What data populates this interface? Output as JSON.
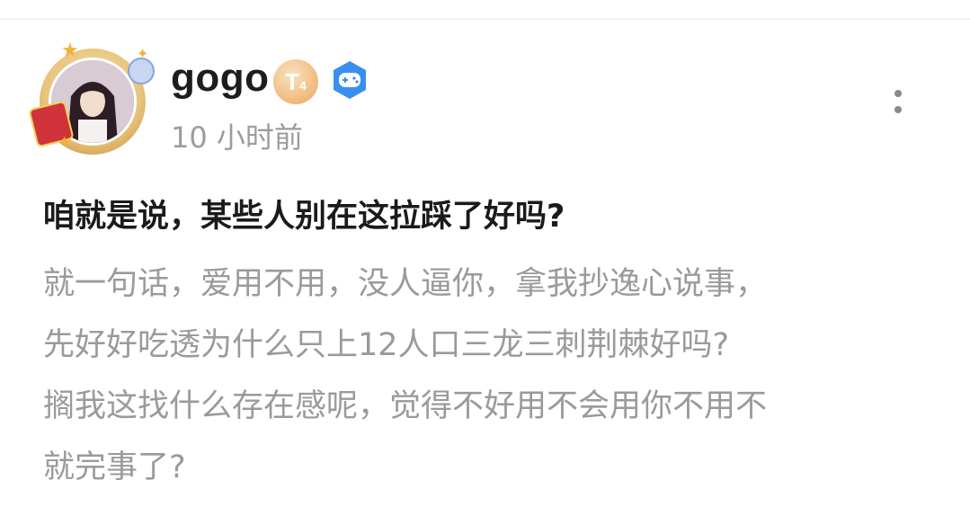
{
  "post": {
    "author": {
      "username": "gogo",
      "level_badge": "T",
      "level_badge_sub": "4",
      "game_badge_icon": "gamepad-icon",
      "timestamp": "10 小时前"
    },
    "title": "咱就是说，某些人别在这拉踩了好吗?",
    "body_lines": [
      "就一句话，爱用不用，没人逼你，拿我抄逸心说事，",
      "先好好吃透为什么只上12人口三龙三刺荆棘好吗?",
      "搁我这找什么存在感呢，觉得不好用不会用你不用不",
      "就完事了?"
    ],
    "more_menu_icon": "vertical-dots-icon"
  },
  "colors": {
    "title": "#1a1a1a",
    "body": "#9a9a9a",
    "timestamp": "#9c9c9c",
    "game_badge": "#3a8ef0",
    "level_badge": "#f0b97a"
  }
}
